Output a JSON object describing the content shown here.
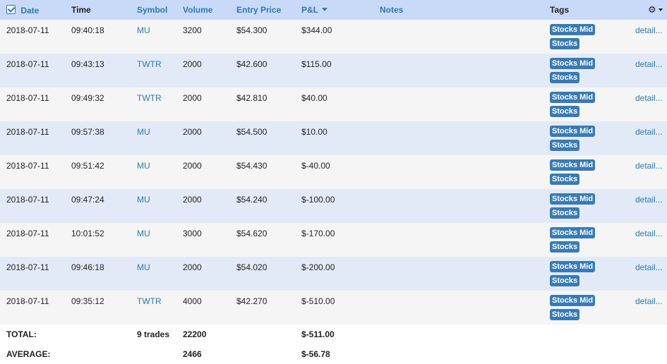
{
  "header": {
    "date": "Date",
    "time": "Time",
    "symbol": "Symbol",
    "volume": "Volume",
    "entry_price": "Entry Price",
    "pnl": "P&L",
    "notes": "Notes",
    "tags": "Tags"
  },
  "rows": [
    {
      "date": "2018-07-11",
      "time": "09:40:18",
      "symbol": "MU",
      "volume": "3200",
      "entry": "$54.300",
      "pnl": "$344.00",
      "tags": [
        "Stocks Mid",
        "Stocks"
      ],
      "detail": "detail..."
    },
    {
      "date": "2018-07-11",
      "time": "09:43:13",
      "symbol": "TWTR",
      "volume": "2000",
      "entry": "$42.600",
      "pnl": "$115.00",
      "tags": [
        "Stocks Mid",
        "Stocks"
      ],
      "detail": "detail..."
    },
    {
      "date": "2018-07-11",
      "time": "09:49:32",
      "symbol": "TWTR",
      "volume": "2000",
      "entry": "$42.810",
      "pnl": "$40.00",
      "tags": [
        "Stocks Mid",
        "Stocks"
      ],
      "detail": "detail..."
    },
    {
      "date": "2018-07-11",
      "time": "09:57:38",
      "symbol": "MU",
      "volume": "2000",
      "entry": "$54.500",
      "pnl": "$10.00",
      "tags": [
        "Stocks Mid",
        "Stocks"
      ],
      "detail": "detail..."
    },
    {
      "date": "2018-07-11",
      "time": "09:51:42",
      "symbol": "MU",
      "volume": "2000",
      "entry": "$54.430",
      "pnl": "$-40.00",
      "tags": [
        "Stocks Mid",
        "Stocks"
      ],
      "detail": "detail..."
    },
    {
      "date": "2018-07-11",
      "time": "09:47:24",
      "symbol": "MU",
      "volume": "2000",
      "entry": "$54.240",
      "pnl": "$-100.00",
      "tags": [
        "Stocks Mid",
        "Stocks"
      ],
      "detail": "detail..."
    },
    {
      "date": "2018-07-11",
      "time": "10:01:52",
      "symbol": "MU",
      "volume": "3000",
      "entry": "$54.620",
      "pnl": "$-170.00",
      "tags": [
        "Stocks Mid",
        "Stocks"
      ],
      "detail": "detail..."
    },
    {
      "date": "2018-07-11",
      "time": "09:46:18",
      "symbol": "MU",
      "volume": "2000",
      "entry": "$54.020",
      "pnl": "$-200.00",
      "tags": [
        "Stocks Mid",
        "Stocks"
      ],
      "detail": "detail..."
    },
    {
      "date": "2018-07-11",
      "time": "09:35:12",
      "symbol": "TWTR",
      "volume": "4000",
      "entry": "$42.270",
      "pnl": "$-510.00",
      "tags": [
        "Stocks Mid",
        "Stocks"
      ],
      "detail": "detail..."
    }
  ],
  "totals": {
    "total_label": "TOTAL:",
    "total_trades": "9 trades",
    "total_volume": "22200",
    "total_pnl": "$-511.00",
    "avg_label": "AVERAGE:",
    "avg_volume": "2466",
    "avg_pnl": "$-56.78"
  },
  "icons": {
    "date_sort": "checkbox-icon",
    "pnl_sort": "sort-desc-icon",
    "settings": "gear-icon"
  },
  "colors": {
    "header_bg": "#c9daf8",
    "link": "#2a7ab0",
    "tag_bg": "#377bb6",
    "row_odd": "#f5f5f5",
    "row_even": "#e3eaf7"
  }
}
